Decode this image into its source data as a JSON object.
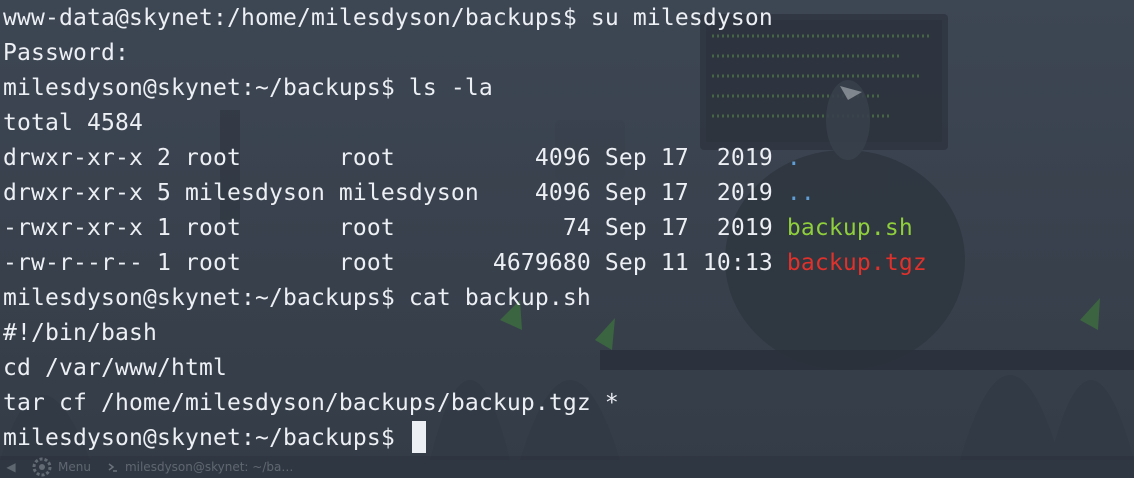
{
  "terminal": {
    "lines": [
      "www-data@skynet:/home/milesdyson/backups$ su milesdyson",
      "Password:",
      "milesdyson@skynet:~/backups$ ls -la",
      "total 4584"
    ],
    "listing": [
      {
        "meta": "drwxr-xr-x 2 root       root          4096 Sep 17  2019 ",
        "name": "."
      },
      {
        "meta": "drwxr-xr-x 5 milesdyson milesdyson    4096 Sep 17  2019 ",
        "name": ".."
      },
      {
        "meta": "-rwxr-xr-x 1 root       root            74 Sep 17  2019 ",
        "name": "backup.sh"
      },
      {
        "meta": "-rw-r--r-- 1 root       root       4679680 Sep 11 10:13 ",
        "name": "backup.tgz"
      }
    ],
    "after_lines": [
      "milesdyson@skynet:~/backups$ cat backup.sh",
      "#!/bin/bash",
      "cd /var/www/html",
      "tar cf /home/milesdyson/backups/backup.tgz *"
    ],
    "prompt": "milesdyson@skynet:~/backups$ ",
    "colors": {
      "text": "#eceff3",
      "directory": "#5f9fd6",
      "executable": "#8fcf3c",
      "archive": "#e0312b",
      "background": "#3a4350"
    }
  },
  "taskbar": {
    "menu_label": "Menu",
    "task_label": "milesdyson@skynet: ~/ba…",
    "menu_icon": "gear-logo-icon",
    "task_icon": "terminal-icon"
  }
}
